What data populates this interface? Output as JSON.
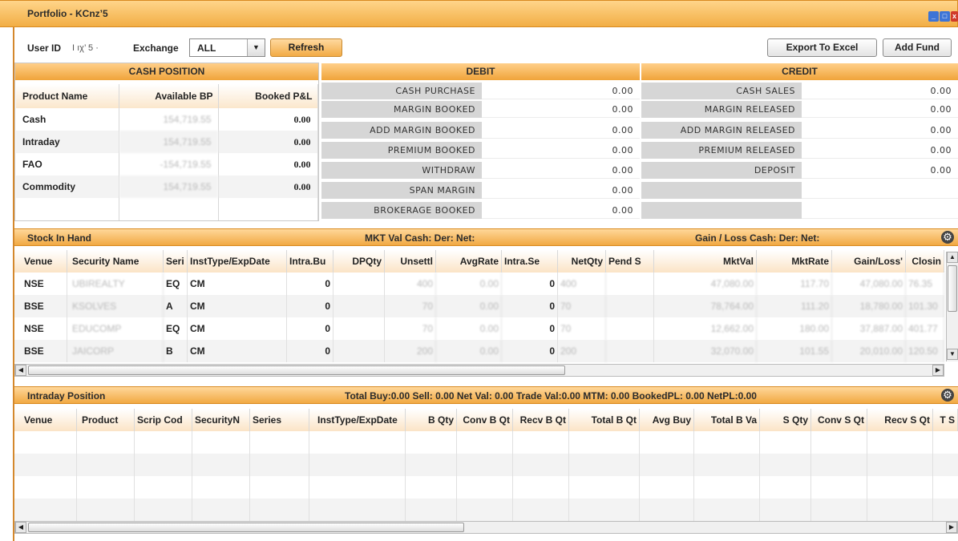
{
  "window": {
    "title": "Portfolio - KCnz’5"
  },
  "toolbar": {
    "user_id_label": "User ID",
    "user_id_value": "I ıχ’ 5 ·",
    "exchange_label": "Exchange",
    "exchange_value": "ALL",
    "refresh": "Refresh",
    "export": "Export To Excel",
    "add_fund": "Add Fund"
  },
  "cash_position": {
    "title": "CASH POSITION",
    "headers": [
      "Product Name",
      "Available BP",
      "Booked P&L"
    ],
    "rows": [
      {
        "name": "Cash",
        "bp": "154,719.55",
        "pl": "0.00"
      },
      {
        "name": "Intraday",
        "bp": "154,719.55",
        "pl": "0.00"
      },
      {
        "name": "FAO",
        "bp": "-154,719.55",
        "pl": "0.00"
      },
      {
        "name": "Commodity",
        "bp": "154,719.55",
        "pl": "0.00"
      }
    ]
  },
  "debit": {
    "title": "DEBIT",
    "rows": [
      {
        "label": "CASH PURCHASE",
        "value": "0.00"
      },
      {
        "label": "MARGIN BOOKED",
        "value": "0.00"
      },
      {
        "label": "ADD MARGIN BOOKED",
        "value": "0.00"
      },
      {
        "label": "PREMIUM BOOKED",
        "value": "0.00"
      },
      {
        "label": "WITHDRAW",
        "value": "0.00"
      },
      {
        "label": "SPAN MARGIN",
        "value": "0.00"
      },
      {
        "label": "BROKERAGE BOOKED",
        "value": "0.00"
      }
    ]
  },
  "credit": {
    "title": "CREDIT",
    "rows": [
      {
        "label": "CASH SALES",
        "value": "0.00"
      },
      {
        "label": "MARGIN RELEASED",
        "value": "0.00"
      },
      {
        "label": "ADD MARGIN RELEASED",
        "value": "0.00"
      },
      {
        "label": "PREMIUM RELEASED",
        "value": "0.00"
      },
      {
        "label": "DEPOSIT",
        "value": "0.00"
      }
    ]
  },
  "stock": {
    "title": "Stock In Hand",
    "mkt_val": "MKT Val  Cash:   Der:     Net:",
    "gain_loss": "Gain / Loss  Cash:  Der:     Net:",
    "headers": [
      "Venue",
      "Security Name",
      "Seri",
      "InstType/ExpDate",
      "Intra.Bu",
      "DPQty",
      "Unsettl",
      "AvgRate",
      "Intra.Se",
      "NetQty",
      "Pend S",
      "MktVal",
      "MktRate",
      "Gain/Loss'",
      "Closin"
    ],
    "rows": [
      {
        "venue": "NSE",
        "security": "UBIREALTY",
        "series": "EQ",
        "inst": "CM",
        "intra_bu": "0",
        "dp": "",
        "unsettled": "400",
        "avg": "0.00",
        "intra_se": "0",
        "net": "400",
        "pend": "",
        "mktval": "47,080.00",
        "mktrate": "117.70",
        "gl": "47,080.00",
        "close": "76.35"
      },
      {
        "venue": "BSE",
        "security": "KSOLVES",
        "series": "A",
        "inst": "CM",
        "intra_bu": "0",
        "dp": "",
        "unsettled": "70",
        "avg": "0.00",
        "intra_se": "0",
        "net": "70",
        "pend": "",
        "mktval": "78,764.00",
        "mktrate": "111.20",
        "gl": "18,780.00",
        "close": "101.30"
      },
      {
        "venue": "NSE",
        "security": "EDUCOMP",
        "series": "EQ",
        "inst": "CM",
        "intra_bu": "0",
        "dp": "",
        "unsettled": "70",
        "avg": "0.00",
        "intra_se": "0",
        "net": "70",
        "pend": "",
        "mktval": "12,662.00",
        "mktrate": "180.00",
        "gl": "37,887.00",
        "close": "401.77"
      },
      {
        "venue": "BSE",
        "security": "JAICORP",
        "series": "B",
        "inst": "CM",
        "intra_bu": "0",
        "dp": "",
        "unsettled": "200",
        "avg": "0.00",
        "intra_se": "0",
        "net": "200",
        "pend": "",
        "mktval": "32,070.00",
        "mktrate": "101.55",
        "gl": "20,010.00",
        "close": "120.50"
      }
    ]
  },
  "intraday": {
    "title": "Intraday Position",
    "summary": "Total Buy:0.00   Sell: 0.00   Net Val: 0.00   Trade Val:0.00   MTM: 0.00   BookedPL: 0.00   NetPL:0.00",
    "headers": [
      "Venue",
      "Product",
      "Scrip Cod",
      "SecurityN",
      "Series",
      "InstType/ExpDate",
      "B Qty",
      "Conv B Qt",
      "Recv B Qt",
      "Total B Qt",
      "Avg Buy",
      "Total B Va",
      "S Qty",
      "Conv S Qt",
      "Recv S Qt",
      "T S"
    ]
  },
  "colors": {
    "accent": "#f2ab45",
    "header_bg": "#ffd58a",
    "label_bg": "#d6d6d6"
  },
  "icons": [
    "settings-gear-icon",
    "dropdown-arrow-icon",
    "minimize-icon",
    "close-icon",
    "scroll-left-icon",
    "scroll-right-icon",
    "scroll-up-icon",
    "scroll-down-icon"
  ]
}
